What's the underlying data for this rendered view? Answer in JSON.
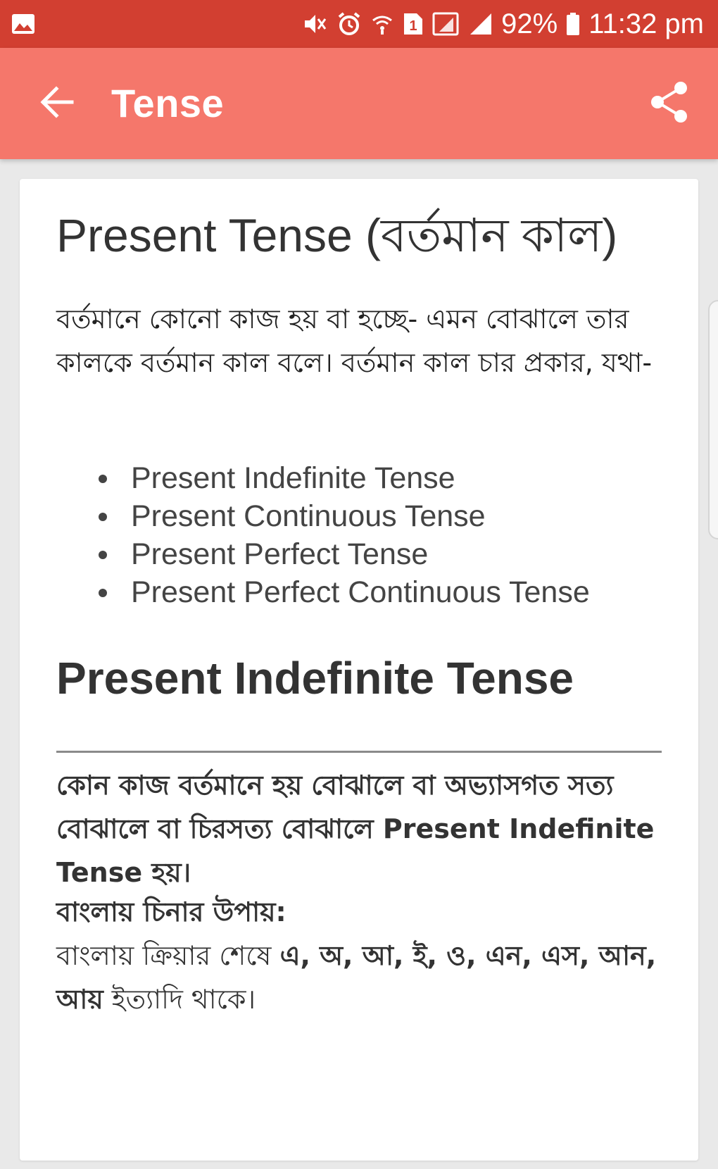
{
  "status_bar": {
    "battery": "92%",
    "time": "11:32 pm",
    "sim_label": "1",
    "icons": [
      "gallery-icon",
      "mute-icon",
      "alarm-icon",
      "wifi-icon",
      "sim-icon",
      "signal-icon",
      "signal-icon",
      "battery-icon"
    ]
  },
  "app_bar": {
    "title": "Tense",
    "back_icon": "arrow-back-icon",
    "share_icon": "share-icon",
    "color": "#f5776b",
    "status_color": "#d23f31"
  },
  "content": {
    "heading": "Present Tense (বর্তমান কাল)",
    "intro": "বর্তমানে কোনো কাজ হয় বা হচ্ছে- এমন বোঝালে তার কালকে বর্তমান কাল বলে। বর্তমান কাল চার প্রকার, যথা-",
    "list": [
      "Present Indefinite Tense",
      "Present Continuous Tense",
      "Present Perfect Tense",
      "Present Perfect Continuous Tense"
    ],
    "subheading": "Present Indefinite Tense",
    "definition": "কোন কাজ বর্তমানে হয় বোঝালে বা অভ্যাসগত সত্য বোঝালে বা চিরসত্য বোঝালে Present Indefinite Tense হয়।",
    "how_title": "বাংলায় চিনার উপায়:",
    "how_prefix": "বাংলায় ক্রিয়ার শেষে ",
    "how_bold": "এ, অ, আ, ই, ও, এন, এস, আন, আয়",
    "how_suffix": " ইত্যাদি থাকে।"
  }
}
